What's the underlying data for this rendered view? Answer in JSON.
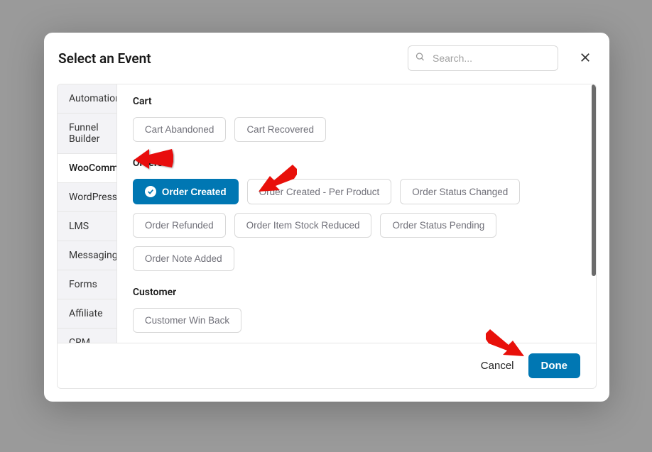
{
  "header": {
    "title": "Select an Event",
    "search_placeholder": "Search..."
  },
  "sidebar": {
    "items": [
      {
        "label": "Automations",
        "active": false
      },
      {
        "label": "Funnel Builder",
        "active": false
      },
      {
        "label": "WooCommerce",
        "active": true
      },
      {
        "label": "WordPress",
        "active": false
      },
      {
        "label": "LMS",
        "active": false
      },
      {
        "label": "Messaging",
        "active": false
      },
      {
        "label": "Forms",
        "active": false
      },
      {
        "label": "Affiliate",
        "active": false
      },
      {
        "label": "CRM",
        "active": false
      }
    ]
  },
  "content": {
    "sections": [
      {
        "title": "Cart",
        "options": [
          {
            "label": "Cart Abandoned",
            "selected": false
          },
          {
            "label": "Cart Recovered",
            "selected": false
          }
        ]
      },
      {
        "title": "Orders",
        "options": [
          {
            "label": "Order Created",
            "selected": true
          },
          {
            "label": "Order Created - Per Product",
            "selected": false
          },
          {
            "label": "Order Status Changed",
            "selected": false
          },
          {
            "label": "Order Refunded",
            "selected": false
          },
          {
            "label": "Order Item Stock Reduced",
            "selected": false
          },
          {
            "label": "Order Status Pending",
            "selected": false
          },
          {
            "label": "Order Note Added",
            "selected": false
          }
        ]
      },
      {
        "title": "Customer",
        "options": [
          {
            "label": "Customer Win Back",
            "selected": false
          }
        ]
      }
    ]
  },
  "footer": {
    "cancel": "Cancel",
    "done": "Done"
  },
  "colors": {
    "primary": "#0077b3",
    "sidebar_bg": "#f3f3f6",
    "border": "#e6e6e6",
    "text": "#1a1a1a",
    "muted": "#707079",
    "arrow": "#e8100a"
  }
}
